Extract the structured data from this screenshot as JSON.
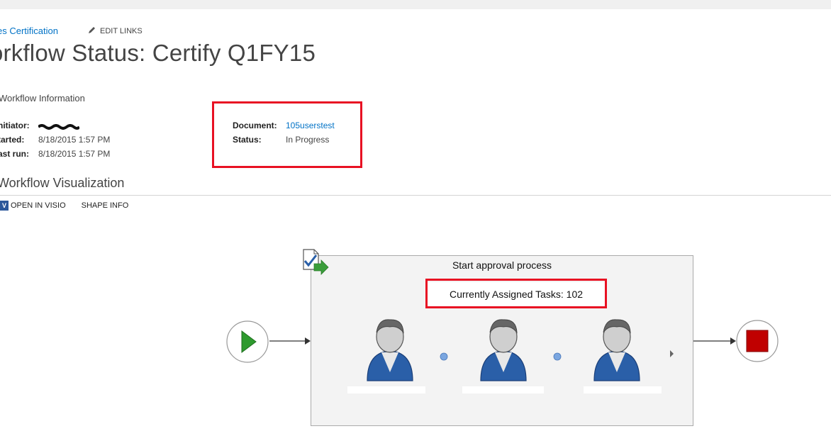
{
  "breadcrumb": {
    "text": "es Certification",
    "edit_links": "EDIT LINKS"
  },
  "page": {
    "title": "orkflow Status: Certify Q1FY15"
  },
  "workflow_info": {
    "heading": "Workflow Information",
    "initiator_label": "nitiator:",
    "started_label": "tarted:",
    "started_value": "8/18/2015 1:57 PM",
    "last_run_label": "ast run:",
    "last_run_value": "8/18/2015 1:57 PM",
    "document_label": "Document:",
    "document_value": "105userstest",
    "status_label": "Status:",
    "status_value": "In Progress"
  },
  "visualization": {
    "heading": "Workflow Visualization",
    "open_in_visio": "OPEN IN VISIO",
    "shape_info": "SHAPE INFO",
    "visio_icon_letter": "V"
  },
  "stage": {
    "title": "Start approval process",
    "tasks": "Currently Assigned Tasks: 102"
  },
  "colors": {
    "highlight": "#e81123",
    "link": "#0072c6",
    "start_green": "#2e9a2e",
    "stop_red": "#c00000",
    "user_blue": "#2a5fa8"
  }
}
